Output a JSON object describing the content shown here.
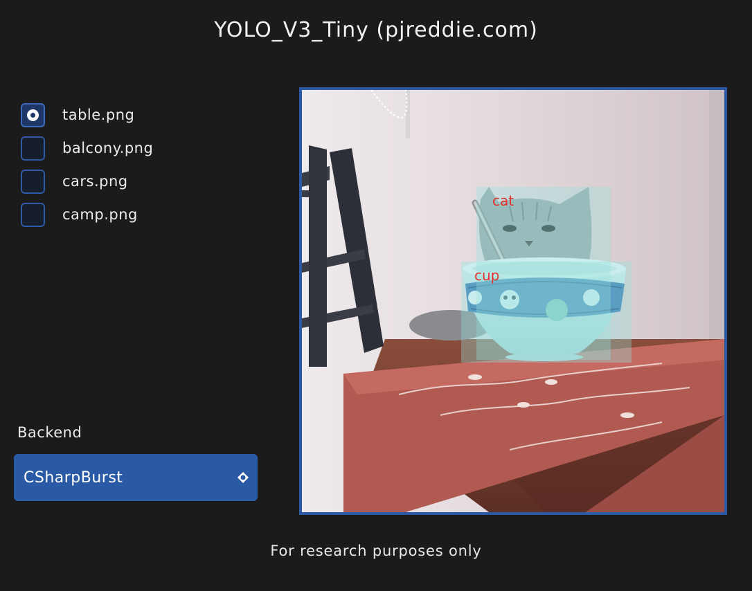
{
  "app": {
    "title": "YOLO_V3_Tiny (pjreddie.com)"
  },
  "images": {
    "items": [
      {
        "label": "table.png",
        "selected": true
      },
      {
        "label": "balcony.png",
        "selected": false
      },
      {
        "label": "cars.png",
        "selected": false
      },
      {
        "label": "camp.png",
        "selected": false
      }
    ]
  },
  "backend": {
    "label": "Backend",
    "value": "CSharpBurst"
  },
  "detections": [
    {
      "label": "cat"
    },
    {
      "label": "cup"
    }
  ],
  "footer": {
    "text": "For research purposes only"
  },
  "colors": {
    "background": "#1b1b1b",
    "accent": "#2a5aa6",
    "detection_label": "#e3302a",
    "detection_box": "#96e1dc"
  }
}
